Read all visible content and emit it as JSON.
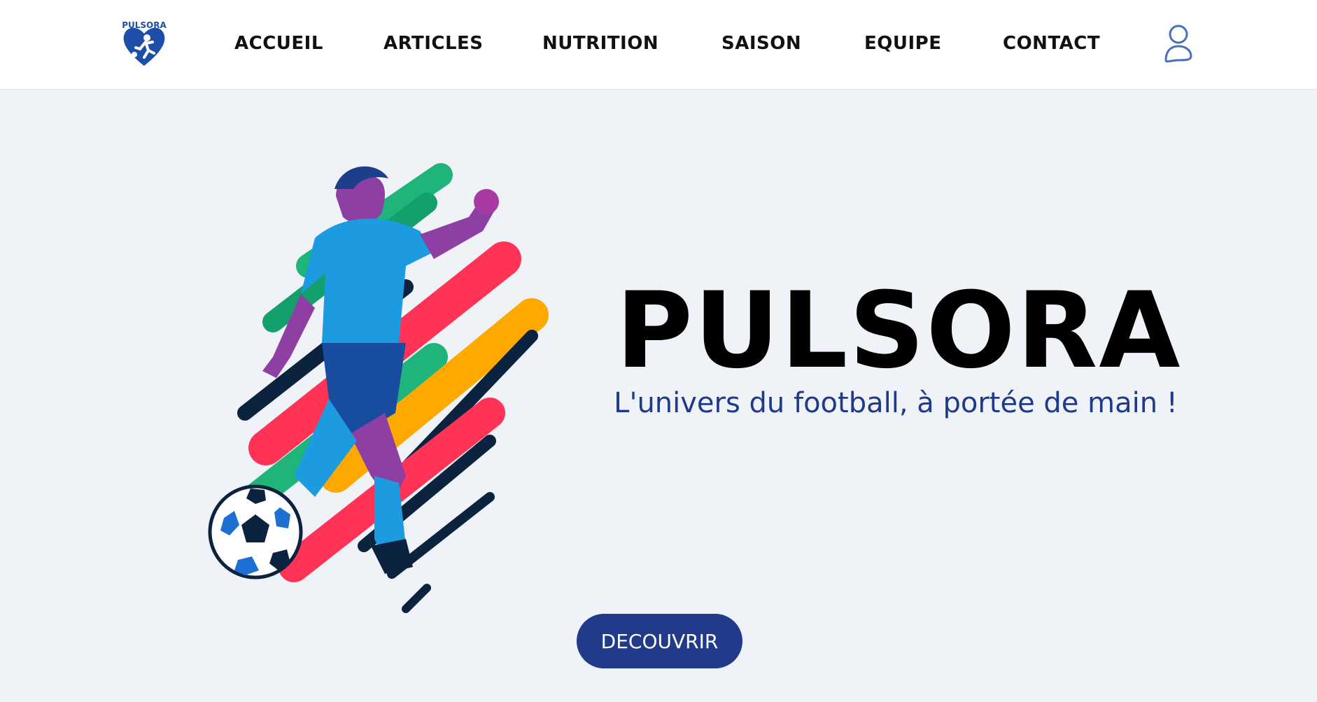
{
  "header": {
    "logo_text": "PULSORA",
    "nav": [
      {
        "label": "ACCUEIL"
      },
      {
        "label": "ARTICLES"
      },
      {
        "label": "NUTRITION"
      },
      {
        "label": "SAISON"
      },
      {
        "label": "EQUIPE"
      },
      {
        "label": "CONTACT"
      }
    ],
    "user_icon": "user-icon"
  },
  "hero": {
    "title": "PULSORA",
    "tagline": "L'univers du football, à portée de main !",
    "cta_label": "DECOUVRIR",
    "illustration": "footballer-kicking-ball-illustration"
  },
  "colors": {
    "navbar_bg": "#ffffff",
    "page_bg": "#eff2f7",
    "accent": "#213a8a",
    "tagline": "#1f3a8a",
    "title": "#000000"
  }
}
